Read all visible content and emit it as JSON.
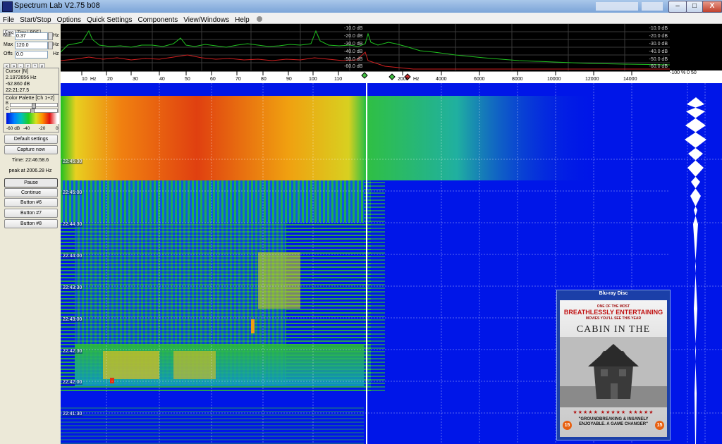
{
  "window": {
    "title": "Spectrum Lab V2.75 b08",
    "minimize": "–",
    "maximize": "□",
    "close": "X"
  },
  "menu": [
    "File",
    "Start/Stop",
    "Options",
    "Quick Settings",
    "Components",
    "View/Windows",
    "Help"
  ],
  "tabs": [
    "Freq",
    "Time",
    "RDF"
  ],
  "freq": {
    "min_label": "Min",
    "min_value": "0.37",
    "max_label": "Max",
    "max_value": "120.0",
    "offs_label": "Offs",
    "offs_value": "0.0",
    "unit": "Hz"
  },
  "nav_arrows": [
    "<",
    ">",
    "-",
    "+",
    "^",
    "v"
  ],
  "cursor": {
    "label": "Cursor [N]",
    "freq": "2.1972656 Hz",
    "level": "-62.860 dB",
    "time": "22:21:27.5"
  },
  "palette": {
    "label": "Color Palette [Ch 1+2]",
    "ticks": [
      "-60 dB",
      "-40",
      "-20",
      "0"
    ],
    "b_label": "B",
    "c_label": "C"
  },
  "buttons": {
    "default_settings": "Default settings",
    "capture": "Capture now",
    "time": "Time:  22:46:58.6",
    "peak": "peak at 2006.28 Hz",
    "pause": "Pause",
    "continue": "Continue",
    "b6": "Button #6",
    "b7": "Button #7",
    "b8": "Button #8"
  },
  "spectrum": {
    "db_labels": [
      "-10.0 dB",
      "-20.0 dB",
      "-30.0 dB",
      "-40.0 dB",
      "-50.0 dB",
      "-60.0 dB"
    ],
    "db_labels_inner": [
      "-10.0 dB",
      "-20.0 dB",
      "-30.0 dB",
      "-40.0 dB",
      "-50.0 dB",
      "-60.0 dB"
    ]
  },
  "freq_scale": [
    "10",
    "Hz",
    "20",
    "30",
    "40",
    "50",
    "60",
    "70",
    "80",
    "90",
    "100",
    "110",
    "2000",
    "Hz",
    "4000",
    "6000",
    "8000",
    "10000",
    "12000",
    "14000"
  ],
  "scope_scale": "-100  %  0  50",
  "waterfall_times": [
    "22:45:30",
    "22:45:00",
    "22:44:30",
    "22:44:00",
    "22:43:30",
    "22:43:00",
    "22:42:30",
    "22:42:00",
    "22:41:30"
  ],
  "colors": {
    "waterfall_bg": "#0016e8",
    "spectrum_green": "#20c020",
    "spectrum_red": "#d02020"
  },
  "bluray": {
    "logo": "Blu-ray Disc",
    "quote_small_top": "ONE OF THE MOST",
    "quote_big": "BREATHLESSLY ENTERTAINING",
    "quote_small_bottom": "MOVIES YOU'LL SEE THIS YEAR",
    "title": "CABIN IN THE WOODS",
    "stars": "★★★★★ ★★★★★ ★★★★★",
    "quote_bottom": "\"GROUNDBREAKING & INSANELY ENJOYABLE. A GAME CHANGER\"",
    "rating": "15"
  }
}
